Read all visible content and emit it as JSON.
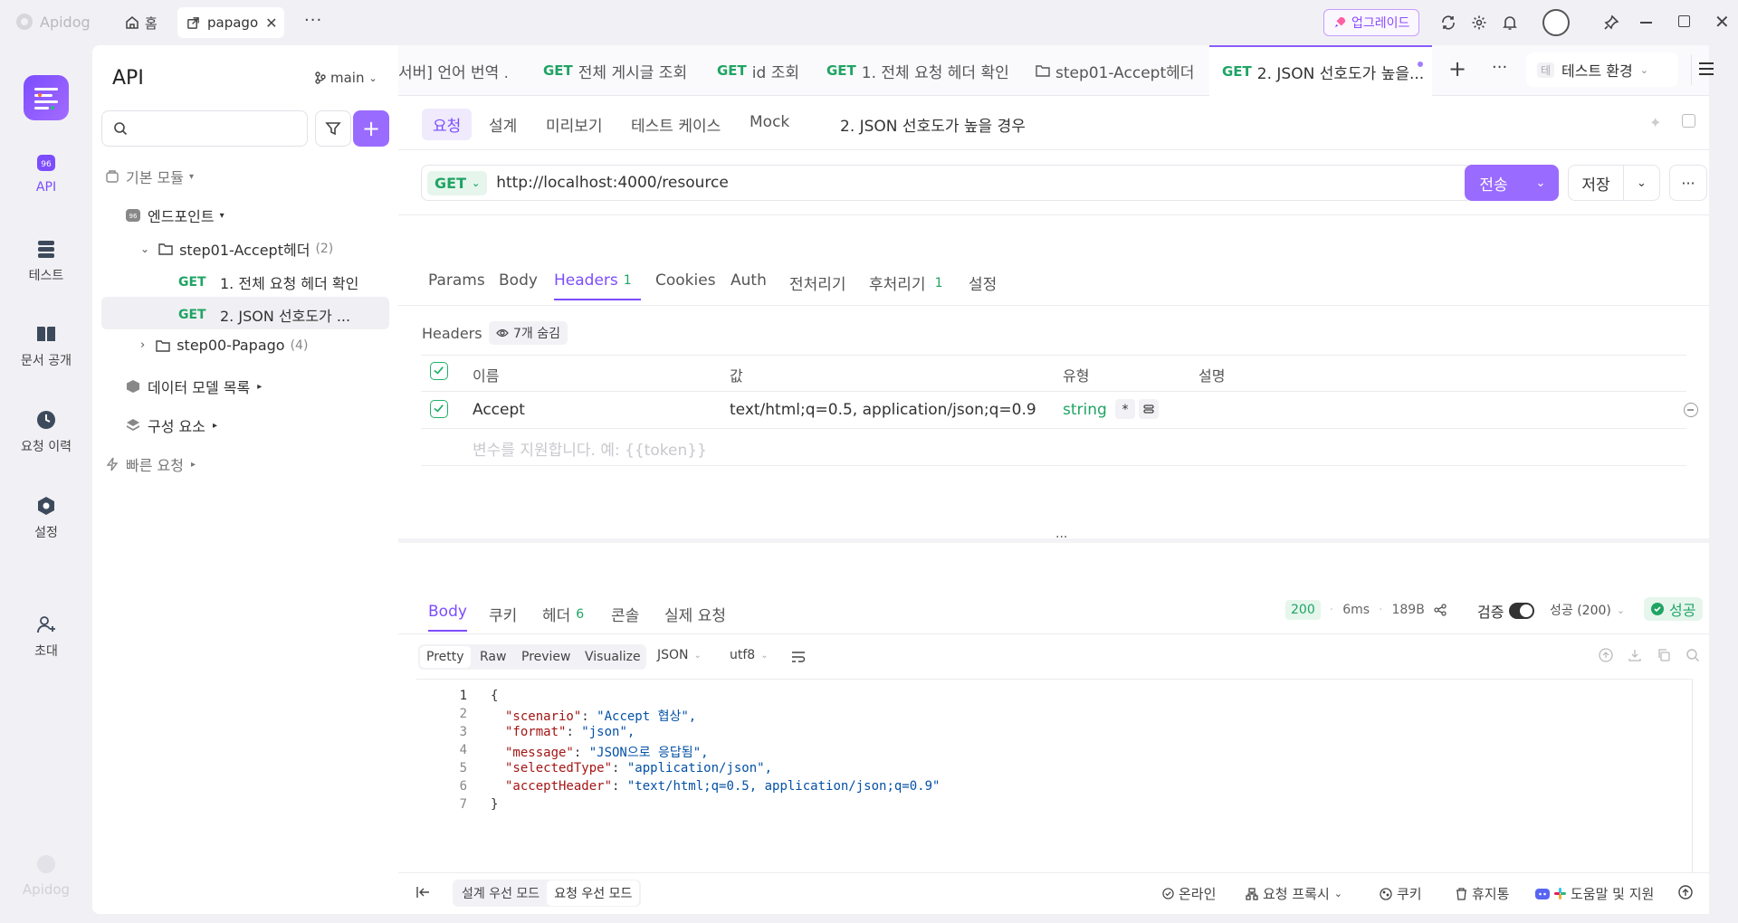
{
  "window": {
    "app_name": "Apidog",
    "home_tab": "홈",
    "project_tab": "papago",
    "upgrade_label": "업그레이드"
  },
  "rail": {
    "items": [
      {
        "label": "API",
        "icon": "api-icon"
      },
      {
        "label": "테스트",
        "icon": "test-icon"
      },
      {
        "label": "문서 공개",
        "icon": "book-icon"
      },
      {
        "label": "요청 이력",
        "icon": "clock-icon"
      },
      {
        "label": "설정",
        "icon": "hexagon-gear-icon"
      },
      {
        "label": "초대",
        "icon": "invite-icon"
      }
    ],
    "footer_logo": "Apidog"
  },
  "sidebar": {
    "title": "API",
    "branch": "main",
    "search_placeholder": "",
    "tree": {
      "default_module": "기본 모듈",
      "endpoints": "엔드포인트",
      "folder1": {
        "name": "step01-Accept헤더",
        "count": "(2)"
      },
      "request1": {
        "method": "GET",
        "name": "1. 전체 요청 헤더 확인"
      },
      "request2": {
        "method": "GET",
        "name": "2. JSON 선호도가 ..."
      },
      "folder2": {
        "name": "step00-Papago",
        "count": "(4)"
      },
      "data_models": "데이터 모델 목록",
      "components": "구성 요소",
      "quick_requests": "빠른 요청"
    }
  },
  "doc_tabs": [
    {
      "method": "",
      "label": "서버] 언어 번역 ..."
    },
    {
      "method": "GET",
      "label": "전체 게시글 조회"
    },
    {
      "method": "GET",
      "label": "id 조회"
    },
    {
      "method": "GET",
      "label": "1. 전체 요청 헤더 확인"
    },
    {
      "method": "",
      "label": "step01-Accept헤더"
    },
    {
      "method": "GET",
      "label": "2. JSON 선호도가 높을..."
    }
  ],
  "environment": {
    "badge": "테",
    "label": "테스트 환경"
  },
  "request_subtabs": [
    "요청",
    "설계",
    "미리보기",
    "테스트 케이스",
    "Mock"
  ],
  "request_name": "2. JSON 선호도가 높을 경우",
  "url_bar": {
    "method": "GET",
    "url": "http://localhost:4000/resource",
    "send_label": "전송",
    "save_label": "저장"
  },
  "param_tabs": [
    {
      "label": "Params",
      "count": ""
    },
    {
      "label": "Body",
      "count": ""
    },
    {
      "label": "Headers",
      "count": "1"
    },
    {
      "label": "Cookies",
      "count": ""
    },
    {
      "label": "Auth",
      "count": ""
    },
    {
      "label": "전처리기",
      "count": ""
    },
    {
      "label": "후처리기",
      "count": "1"
    },
    {
      "label": "설정",
      "count": ""
    }
  ],
  "headers": {
    "section_label": "Headers",
    "hidden_label": "7개 숨김",
    "columns": [
      "이름",
      "값",
      "유형",
      "설명"
    ],
    "rows": [
      {
        "name": "Accept",
        "value": "text/html;q=0.5, application/json;q=0.9",
        "type": "string",
        "description": ""
      }
    ],
    "placeholder": "변수를 지원합니다. 예: {{token}}"
  },
  "response": {
    "tabs": [
      {
        "label": "Body",
        "count": ""
      },
      {
        "label": "쿠키",
        "count": ""
      },
      {
        "label": "헤더",
        "count": "6"
      },
      {
        "label": "콘솔",
        "count": ""
      },
      {
        "label": "실제 요청",
        "count": ""
      }
    ],
    "status_code": "200",
    "time": "6ms",
    "size": "189B",
    "validate_label": "검증",
    "validate_result": "성공 (200)",
    "success_label": "성공",
    "format_tabs": [
      "Pretty",
      "Raw",
      "Preview",
      "Visualize"
    ],
    "format": "JSON",
    "encoding": "utf8",
    "body_lines": [
      {
        "n": "1",
        "text": "{"
      },
      {
        "n": "2",
        "key": "\"scenario\"",
        "val": "\"Accept 협상\","
      },
      {
        "n": "3",
        "key": "\"format\"",
        "val": "\"json\","
      },
      {
        "n": "4",
        "key": "\"message\"",
        "val": "\"JSON으로 응답됨\","
      },
      {
        "n": "5",
        "key": "\"selectedType\"",
        "val": "\"application/json\","
      },
      {
        "n": "6",
        "key": "\"acceptHeader\"",
        "val": "\"text/html;q=0.5, application/json;q=0.9\""
      },
      {
        "n": "7",
        "text": "}"
      }
    ]
  },
  "footer": {
    "mode_design": "설계 우선 모드",
    "mode_request": "요청 우선 모드",
    "online": "온라인",
    "proxy": "요청 프록시",
    "cookie": "쿠키",
    "trash": "휴지통",
    "help": "도움말 및 지원"
  }
}
